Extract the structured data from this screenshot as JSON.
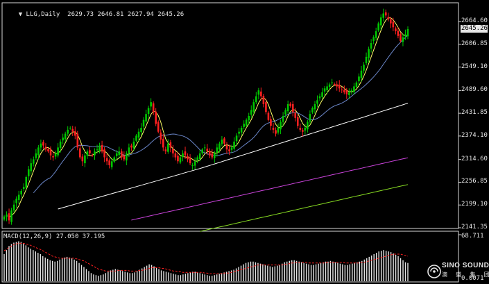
{
  "header": {
    "symbol": "LLG,Daily",
    "ohlc": "2629.73 2646.81 2627.94 2645.26"
  },
  "current_price": "2645.26",
  "price_axis": [
    "2664.60",
    "2606.85",
    "2549.10",
    "2489.60",
    "2431.85",
    "2374.10",
    "2314.60",
    "2256.85",
    "2199.10",
    "2141.35"
  ],
  "macd": {
    "label": "MACD(12,26,9) 27.050 37.195",
    "axis_top": "68.711",
    "axis_bottom": "0.0071"
  },
  "logo": {
    "title": "SINO SOUND",
    "subtitle": "澳 盛 集 团"
  },
  "colors": {
    "background": "#000000",
    "up_candle": "#00c800",
    "down_candle": "#ff2020",
    "ma_fast": "#ffff66",
    "ma_mid": "#6a86c8",
    "ma_slow": "#ffffff",
    "ma_purple": "#cc44dd",
    "ma_green": "#88dd22",
    "signal": "#ff2020",
    "hist": "#e6e6e6",
    "grid": "#d8d8d8"
  },
  "chart_data": {
    "type": "candlestick",
    "title": "LLG,Daily",
    "ylim": [
      2141.35,
      2700
    ],
    "y_ticks": [
      2664.6,
      2606.85,
      2549.1,
      2489.6,
      2431.85,
      2374.1,
      2314.6,
      2256.85,
      2199.1,
      2141.35
    ],
    "last": {
      "open": 2629.73,
      "high": 2646.81,
      "low": 2627.94,
      "close": 2645.26
    },
    "closes": [
      2170,
      2175,
      2160,
      2185,
      2200,
      2215,
      2225,
      2235,
      2245,
      2270,
      2290,
      2305,
      2315,
      2330,
      2345,
      2355,
      2350,
      2340,
      2335,
      2325,
      2320,
      2330,
      2345,
      2360,
      2370,
      2380,
      2390,
      2395,
      2385,
      2375,
      2345,
      2320,
      2310,
      2325,
      2335,
      2330,
      2325,
      2335,
      2340,
      2350,
      2335,
      2320,
      2310,
      2300,
      2310,
      2320,
      2330,
      2335,
      2320,
      2315,
      2330,
      2345,
      2345,
      2360,
      2375,
      2385,
      2395,
      2415,
      2430,
      2445,
      2460,
      2435,
      2405,
      2385,
      2365,
      2345,
      2335,
      2355,
      2345,
      2330,
      2320,
      2310,
      2320,
      2330,
      2325,
      2315,
      2305,
      2300,
      2310,
      2320,
      2330,
      2340,
      2345,
      2335,
      2325,
      2320,
      2330,
      2345,
      2355,
      2365,
      2355,
      2340,
      2335,
      2345,
      2360,
      2375,
      2385,
      2395,
      2405,
      2415,
      2425,
      2440,
      2460,
      2475,
      2490,
      2475,
      2455,
      2435,
      2415,
      2400,
      2390,
      2380,
      2395,
      2410,
      2425,
      2440,
      2455,
      2450,
      2435,
      2420,
      2400,
      2390,
      2385,
      2395,
      2410,
      2430,
      2445,
      2455,
      2465,
      2475,
      2485,
      2495,
      2500,
      2505,
      2510,
      2505,
      2500,
      2495,
      2490,
      2485,
      2480,
      2485,
      2490,
      2500,
      2510,
      2525,
      2540,
      2555,
      2575,
      2595,
      2610,
      2625,
      2640,
      2660,
      2675,
      2685,
      2680,
      2670,
      2660,
      2650,
      2640,
      2628,
      2615,
      2625,
      2632,
      2645.26
    ],
    "ma_lines": [
      {
        "name": "MA5",
        "color": "#ffff66"
      },
      {
        "name": "MA20",
        "color": "#6a86c8"
      },
      {
        "name": "MA60",
        "color": "#ffffff"
      },
      {
        "name": "MA120",
        "color": "#cc44dd"
      },
      {
        "name": "MA200",
        "color": "#88dd22"
      }
    ],
    "macd": {
      "fast": 12,
      "slow": 26,
      "signal": 9,
      "value": 27.05,
      "signal_value": 37.195,
      "ylim": [
        0.0071,
        68.711
      ],
      "hist": [
        40,
        46,
        52,
        55,
        57,
        58,
        59,
        58,
        56,
        53,
        50,
        48,
        46,
        44,
        42,
        40,
        37,
        35,
        33,
        31,
        30,
        29,
        30,
        32,
        34,
        35,
        36,
        35,
        34,
        32,
        30,
        27,
        24,
        21,
        18,
        15,
        12,
        10,
        9,
        8,
        9,
        10,
        12,
        14,
        16,
        17,
        18,
        17,
        16,
        15,
        14,
        13,
        12,
        12,
        13,
        15,
        17,
        19,
        21,
        23,
        25,
        24,
        22,
        20,
        18,
        16,
        15,
        14,
        13,
        12,
        11,
        10,
        9,
        9,
        10,
        11,
        12,
        13,
        14,
        14,
        13,
        12,
        11,
        10,
        9,
        8,
        8,
        9,
        10,
        11,
        12,
        13,
        14,
        15,
        16,
        17,
        19,
        21,
        23,
        25,
        27,
        28,
        29,
        29,
        28,
        27,
        26,
        25,
        24,
        23,
        22,
        21,
        22,
        23,
        24,
        26,
        28,
        29,
        30,
        31,
        31,
        30,
        29,
        28,
        27,
        26,
        25,
        24,
        24,
        25,
        26,
        27,
        28,
        29,
        29,
        30,
        29,
        28,
        27,
        26,
        25,
        24,
        24,
        25,
        26,
        27,
        28,
        29,
        30,
        32,
        34,
        36,
        38,
        40,
        42,
        44,
        45,
        46,
        45,
        44,
        43,
        41,
        39,
        37,
        34,
        31,
        28,
        27
      ],
      "signal_line": [
        45,
        47,
        50,
        52,
        54,
        55,
        56,
        56,
        56,
        55,
        54,
        53,
        51,
        50,
        48,
        47,
        45,
        43,
        41,
        39,
        37,
        36,
        35,
        34,
        34,
        34,
        34,
        34,
        34,
        34,
        33,
        32,
        31,
        30,
        28,
        26,
        24,
        22,
        20,
        18,
        17,
        16,
        15,
        15,
        15,
        15,
        15,
        16,
        16,
        16,
        16,
        16,
        15,
        15,
        15,
        15,
        16,
        16,
        17,
        18,
        19,
        20,
        20,
        20,
        20,
        19,
        19,
        18,
        17,
        16,
        15,
        15,
        14,
        14,
        13,
        13,
        13,
        13,
        13,
        13,
        13,
        13,
        13,
        12,
        12,
        11,
        11,
        11,
        11,
        11,
        11,
        12,
        12,
        12,
        13,
        14,
        15,
        16,
        17,
        18,
        19,
        20,
        21,
        22,
        23,
        24,
        24,
        24,
        24,
        24,
        24,
        24,
        24,
        24,
        24,
        24,
        25,
        25,
        26,
        27,
        27,
        28,
        28,
        28,
        28,
        28,
        27,
        27,
        27,
        27,
        27,
        27,
        27,
        27,
        28,
        28,
        28,
        28,
        28,
        28,
        28,
        27,
        27,
        27,
        27,
        27,
        27,
        27,
        28,
        28,
        29,
        30,
        31,
        32,
        33,
        34,
        35,
        36,
        37,
        38,
        39,
        40,
        40,
        40,
        40,
        39,
        38,
        37
      ]
    }
  }
}
